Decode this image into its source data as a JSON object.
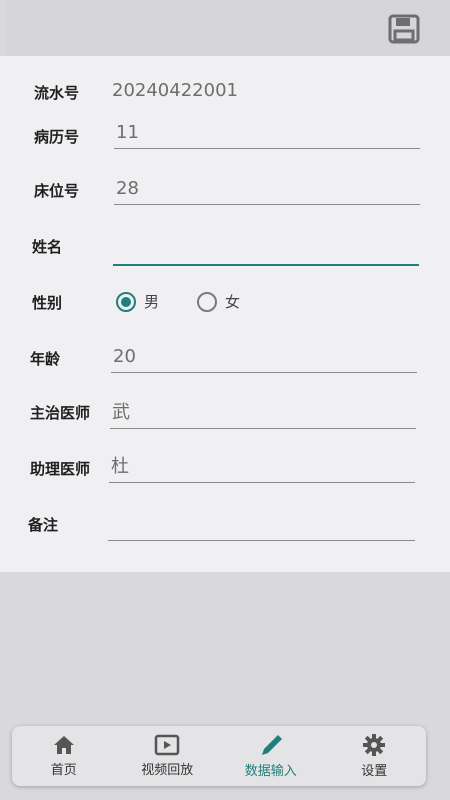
{
  "toolbar": {
    "save_icon": "save-icon"
  },
  "form": {
    "serial": {
      "label": "流水号",
      "value": "20240422001"
    },
    "record": {
      "label": "病历号",
      "value": "11"
    },
    "bed": {
      "label": "床位号",
      "value": "28"
    },
    "name": {
      "label": "姓名",
      "value": ""
    },
    "gender": {
      "label": "性别",
      "options": [
        "男",
        "女"
      ],
      "selected": "男"
    },
    "age": {
      "label": "年龄",
      "value": "20"
    },
    "doctor": {
      "label": "主治医师",
      "value": "武"
    },
    "assistant": {
      "label": "助理医师",
      "value": "杜"
    },
    "note": {
      "label": "备注",
      "value": ""
    }
  },
  "nav": {
    "items": [
      {
        "label": "首页",
        "icon": "home-icon"
      },
      {
        "label": "视频回放",
        "icon": "video-playback-icon"
      },
      {
        "label": "数据输入",
        "icon": "pencil-icon"
      },
      {
        "label": "设置",
        "icon": "gear-icon"
      }
    ],
    "active": "数据输入",
    "accent_color": "#1f7f7a"
  }
}
